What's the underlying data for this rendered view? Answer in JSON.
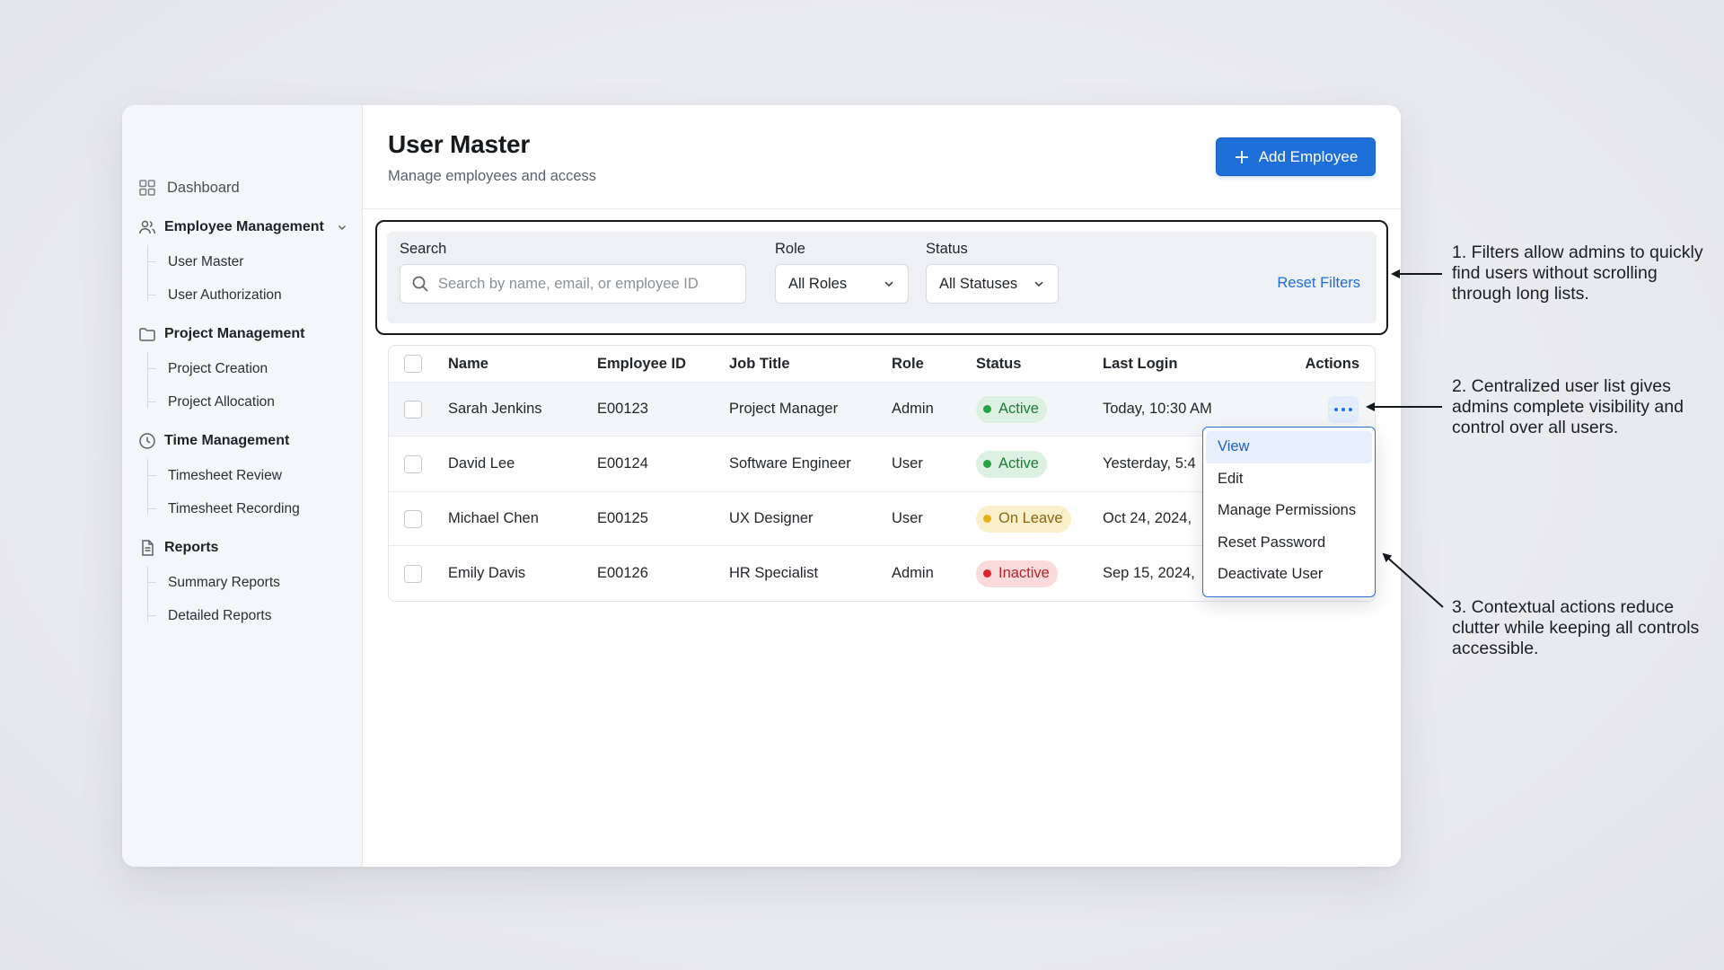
{
  "sidebar": {
    "dashboard": "Dashboard",
    "groups": [
      {
        "label": "Employee Management",
        "icon": "users-icon",
        "items": [
          "User Master",
          "User Authorization"
        ]
      },
      {
        "label": "Project Management",
        "icon": "folder-icon",
        "items": [
          "Project Creation",
          "Project Allocation"
        ]
      },
      {
        "label": "Time Management",
        "icon": "clock-icon",
        "items": [
          "Timesheet Review",
          "Timesheet Recording"
        ]
      },
      {
        "label": "Reports",
        "icon": "document-icon",
        "items": [
          "Summary Reports",
          "Detailed Reports"
        ]
      }
    ]
  },
  "header": {
    "title": "User Master",
    "subtitle": "Manage employees and access",
    "add_button": "Add Employee"
  },
  "filters": {
    "search_label": "Search",
    "search_placeholder": "Search by name, email, or employee ID",
    "role_label": "Role",
    "role_value": "All Roles",
    "status_label": "Status",
    "status_value": "All Statuses",
    "reset": "Reset Filters"
  },
  "table": {
    "columns": [
      "Name",
      "Employee ID",
      "Job Title",
      "Role",
      "Status",
      "Last Login",
      "Actions"
    ],
    "rows": [
      {
        "name": "Sarah Jenkins",
        "id": "E00123",
        "title": "Project Manager",
        "role": "Admin",
        "status": "Active",
        "status_kind": "active",
        "login": "Today, 10:30 AM"
      },
      {
        "name": "David Lee",
        "id": "E00124",
        "title": "Software Engineer",
        "role": "User",
        "status": "Active",
        "status_kind": "active",
        "login": "Yesterday, 5:4"
      },
      {
        "name": "Michael Chen",
        "id": "E00125",
        "title": "UX Designer",
        "role": "User",
        "status": "On Leave",
        "status_kind": "leave",
        "login": "Oct 24, 2024,"
      },
      {
        "name": "Emily Davis",
        "id": "E00126",
        "title": "HR Specialist",
        "role": "Admin",
        "status": "Inactive",
        "status_kind": "inactive",
        "login": "Sep 15, 2024,"
      }
    ]
  },
  "actions_menu": {
    "items": [
      "View",
      "Edit",
      "Manage Permissions",
      "Reset Password",
      "Deactivate User"
    ],
    "selected": "View"
  },
  "annotations": [
    "1. Filters allow admins to quickly find users without scrolling through long lists.",
    "2. Centralized user list gives admins complete visibility and control over all users.",
    "3. Contextual actions reduce clutter while keeping all controls accessible."
  ],
  "colors": {
    "accent": "#1f6fd8",
    "active": "#22a447",
    "on_leave": "#e8b21a",
    "inactive": "#d8262e"
  }
}
